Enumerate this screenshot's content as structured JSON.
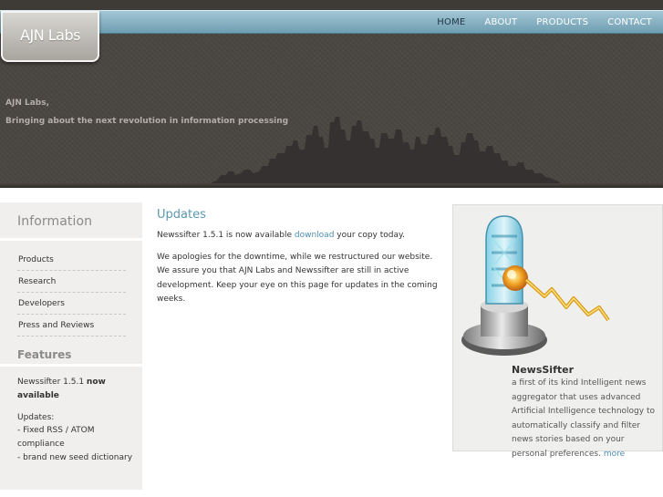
{
  "header": {
    "logo": "AJN Labs",
    "nav": [
      {
        "label": "HOME",
        "active": true
      },
      {
        "label": "ABOUT",
        "active": false
      },
      {
        "label": "PRODUCTS",
        "active": false
      },
      {
        "label": "CONTACT",
        "active": false
      }
    ],
    "tagline": [
      "AJN Labs,",
      "Bringing about the next revolution in information processing"
    ]
  },
  "sidebar": {
    "title": "Information",
    "items": [
      "Products",
      "Research",
      "Developers",
      "Press and Reviews"
    ],
    "features": {
      "title": "Features",
      "lead": "Newssifter 1.5.1",
      "lead_bold": "now available",
      "updates_label": "Updates:",
      "updates": [
        "- Fixed RSS / ATOM compliance",
        "- brand new seed dictionary"
      ]
    }
  },
  "main": {
    "title": "Updates",
    "p1_before": "Newssifter 1.5.1 is now available",
    "p1_link": "download",
    "p1_after": "your copy today.",
    "p2": "We apologies for the downtime, while we restructured our website. We assure you that AJN Labs and Newssifter are still in active development. Keep your eye on this page for updates in the coming weeks."
  },
  "panel": {
    "title": "NewsSifter",
    "description": "a first of its kind Intelligent news aggregator that uses advanced Artificial Intelligence technology to automatically classify and filter news stories based on your personal preferences.",
    "more": "more"
  },
  "colors": {
    "nav_bar": "#8cb7ca",
    "header_bg": "#4a4641",
    "accent_title": "#5b98b0",
    "link": "#4d8fb0",
    "sidebar_bg": "#f0efed"
  }
}
